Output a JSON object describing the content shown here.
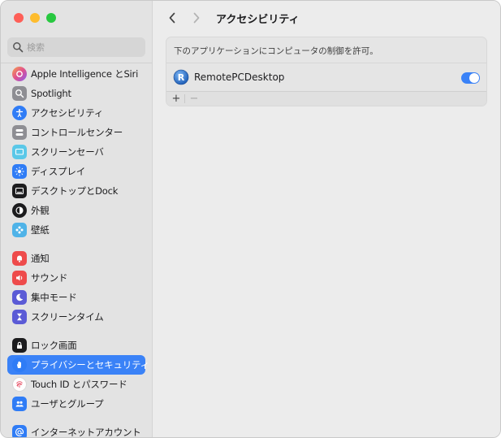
{
  "sidebar": {
    "search_placeholder": "検索",
    "items": [
      {
        "label": "Apple Intelligence とSiri",
        "icon": "apple-intelligence-icon",
        "color": "#e86a8e"
      },
      {
        "label": "Spotlight",
        "icon": "spotlight-icon",
        "color": "#8e8e93"
      },
      {
        "label": "アクセシビリティ",
        "icon": "accessibility-icon",
        "color": "#2f7cf6"
      },
      {
        "label": "コントロールセンター",
        "icon": "control-center-icon",
        "color": "#8e8e93"
      },
      {
        "label": "スクリーンセーバ",
        "icon": "screensaver-icon",
        "color": "#5ac8e8"
      },
      {
        "label": "ディスプレイ",
        "icon": "display-icon",
        "color": "#2f7cf6"
      },
      {
        "label": "デスクトップとDock",
        "icon": "dock-icon",
        "color": "#1c1c1e"
      },
      {
        "label": "外観",
        "icon": "appearance-icon",
        "color": "#1c1c1e"
      },
      {
        "label": "壁紙",
        "icon": "wallpaper-icon",
        "color": "#4fb3e8"
      },
      {
        "label": "通知",
        "icon": "notifications-icon",
        "color": "#ee4b4b"
      },
      {
        "label": "サウンド",
        "icon": "sound-icon",
        "color": "#ee4b4b"
      },
      {
        "label": "集中モード",
        "icon": "focus-icon",
        "color": "#5b5bd6"
      },
      {
        "label": "スクリーンタイム",
        "icon": "screen-time-icon",
        "color": "#5b5bd6"
      },
      {
        "label": "ロック画面",
        "icon": "lock-screen-icon",
        "color": "#1c1c1e"
      },
      {
        "label": "プライバシーとセキュリティ",
        "icon": "privacy-hand-icon",
        "color": "#2f7cf6"
      },
      {
        "label": "Touch ID とパスワード",
        "icon": "fingerprint-icon",
        "color": "#ffffff"
      },
      {
        "label": "ユーザとグループ",
        "icon": "users-icon",
        "color": "#2f7cf6"
      },
      {
        "label": "インターネットアカウント",
        "icon": "internet-accounts-icon",
        "color": "#2f7cf6"
      }
    ]
  },
  "header": {
    "title": "アクセシビリティ"
  },
  "panel": {
    "description": "下のアプリケーションにコンピュータの制御を許可。",
    "app_name": "RemotePCDesktop",
    "app_enabled": true,
    "add_label": "+",
    "remove_label": "−"
  },
  "colors": {
    "accent": "#3a82f7",
    "sidebar_bg": "#e3e3e3",
    "content_bg": "#ececec"
  }
}
